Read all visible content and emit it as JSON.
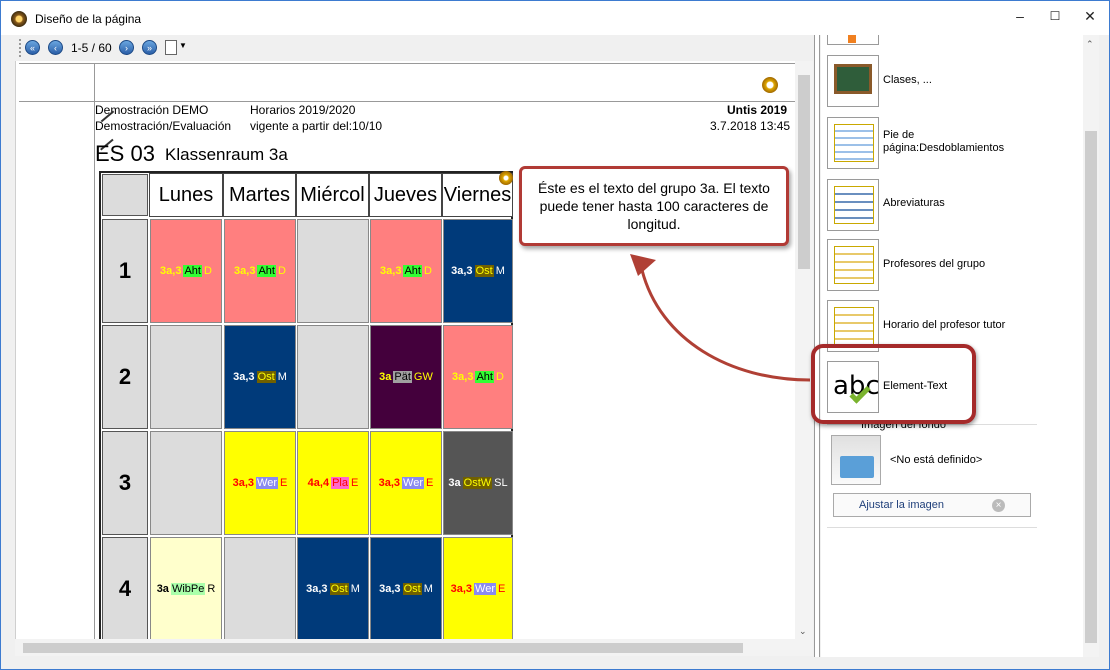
{
  "window": {
    "title": "Diseño de la página",
    "controls": {
      "minimize": "–",
      "maximize": "☐",
      "close": "✕"
    }
  },
  "toolbar": {
    "page_count": "1-5 / 60"
  },
  "header": {
    "school": "Demostración  DEMO",
    "school_sub": "Demostración/Evaluación",
    "schedule": "Horarios 2019/2020",
    "valid_from": "vigente a partir del:10/10",
    "product": "Untis 2019",
    "printed": "3.7.2018  13:45",
    "class_code": "ES 03",
    "class_room": "Klassenraum 3a"
  },
  "timetable": {
    "days": [
      "Lunes",
      "Martes",
      "Miércol",
      "Jueves",
      "Viernes"
    ],
    "periods": [
      "1",
      "2",
      "3",
      "4"
    ],
    "cells": [
      [
        {
          "bg": "#ff7f7f",
          "a": "3a,3",
          "b": "Aht",
          "c": "D",
          "ta": "#ffff00",
          "tb": "#000000",
          "hb": "#33ff33",
          "tc": "#ffff00"
        },
        {
          "bg": "#ff7f7f",
          "a": "3a,3",
          "b": "Aht",
          "c": "D",
          "ta": "#ffff00",
          "tb": "#000000",
          "hb": "#33ff33",
          "tc": "#ffff00"
        },
        {
          "bg": "#dcdcdc",
          "a": "",
          "b": "",
          "c": ""
        },
        {
          "bg": "#ff7f7f",
          "a": "3a,3",
          "b": "Aht",
          "c": "D",
          "ta": "#ffff00",
          "tb": "#000000",
          "hb": "#33ff33",
          "tc": "#ffff00"
        },
        {
          "bg": "#003a7a",
          "a": "3a,3",
          "b": "Ost",
          "c": "M",
          "ta": "#ffffff",
          "tb": "#ffff00",
          "hb": "#706000",
          "tc": "#ffffff"
        }
      ],
      [
        {
          "bg": "#dcdcdc",
          "a": "",
          "b": "",
          "c": ""
        },
        {
          "bg": "#003a7a",
          "a": "3a,3",
          "b": "Ost",
          "c": "M",
          "ta": "#ffffff",
          "tb": "#ffff00",
          "hb": "#706000",
          "tc": "#ffffff"
        },
        {
          "bg": "#dcdcdc",
          "a": "",
          "b": "",
          "c": ""
        },
        {
          "bg": "#44003c",
          "a": "3a",
          "b": "Pät",
          "c": "GW",
          "ta": "#ffff00",
          "tb": "#000000",
          "hb": "#a0a0a0",
          "tc": "#ffff00"
        },
        {
          "bg": "#ff7f7f",
          "a": "3a,3",
          "b": "Aht",
          "c": "D",
          "ta": "#ffff00",
          "tb": "#000000",
          "hb": "#33ff33",
          "tc": "#ffff00"
        }
      ],
      [
        {
          "bg": "#dcdcdc",
          "a": "",
          "b": "",
          "c": ""
        },
        {
          "bg": "#ffff00",
          "a": "3a,3",
          "b": "Wer",
          "c": "E",
          "ta": "#ff0000",
          "tb": "#ffffff",
          "hb": "#8a8af0",
          "tc": "#ff0000"
        },
        {
          "bg": "#ffff00",
          "a": "4a,4",
          "b": "Pla",
          "c": "E",
          "ta": "#ff0000",
          "tb": "#ff0000",
          "hb": "#ff66cc",
          "tc": "#ff0000"
        },
        {
          "bg": "#ffff00",
          "a": "3a,3",
          "b": "Wer",
          "c": "E",
          "ta": "#ff0000",
          "tb": "#ffffff",
          "hb": "#8a8af0",
          "tc": "#ff0000"
        },
        {
          "bg": "#555555",
          "a": "3a",
          "b": "OstW",
          "c": "SL",
          "ta": "#ffffff",
          "tb": "#ffff00",
          "hb": "#706000",
          "tc": "#ffffff"
        }
      ],
      [
        {
          "bg": "#ffffcc",
          "a": "3a",
          "b": "WibPe",
          "c": "R",
          "ta": "#000000",
          "tb": "#000000",
          "hb": "#aaffaa",
          "tc": "#000000"
        },
        {
          "bg": "#dcdcdc",
          "a": "",
          "b": "",
          "c": ""
        },
        {
          "bg": "#003a7a",
          "a": "3a,3",
          "b": "Ost",
          "c": "M",
          "ta": "#ffffff",
          "tb": "#ffff00",
          "hb": "#706000",
          "tc": "#ffffff"
        },
        {
          "bg": "#003a7a",
          "a": "3a,3",
          "b": "Ost",
          "c": "M",
          "ta": "#ffffff",
          "tb": "#ffff00",
          "hb": "#706000",
          "tc": "#ffffff"
        },
        {
          "bg": "#ffff00",
          "a": "3a,3",
          "b": "Wer",
          "c": "E",
          "ta": "#ff0000",
          "tb": "#ffffff",
          "hb": "#8a8af0",
          "tc": "#ff0000"
        }
      ]
    ]
  },
  "callout": {
    "text": "Éste es el texto del grupo 3a. El texto puede tener hasta 100 caracteres de longitud."
  },
  "right_panel": {
    "items": [
      {
        "label": "Clases, ...",
        "icon": "class-board-icon"
      },
      {
        "label": "Pie de página:Desdoblamientos",
        "icon": "table-split-icon"
      },
      {
        "label": "Abreviaturas",
        "icon": "abbreviations-icon"
      },
      {
        "label": "Profesores del grupo",
        "icon": "group-teachers-icon"
      },
      {
        "label": "Horario del profesor tutor",
        "icon": "tutor-timetable-icon"
      },
      {
        "label": "Element-Text",
        "icon": "element-text-icon",
        "icon_text": "abc"
      }
    ],
    "background_section": {
      "title": "Imagen del fondo",
      "value": "<No está definido>",
      "adjust_button": "Ajustar la imagen"
    }
  },
  "colors": {
    "accent": "#2b5fa8",
    "highlight": "#a52a2a",
    "arrow": "#b04035"
  }
}
